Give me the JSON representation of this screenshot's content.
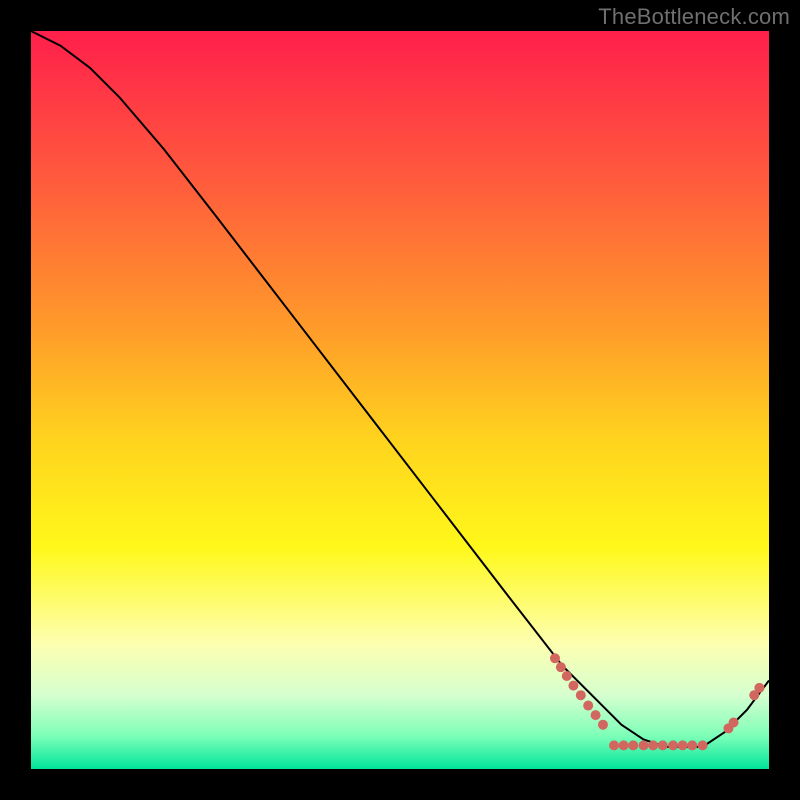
{
  "watermark": "TheBottleneck.com",
  "chart_data": {
    "type": "line",
    "title": "",
    "xlabel": "",
    "ylabel": "",
    "xlim": [
      0,
      100
    ],
    "ylim": [
      0,
      100
    ],
    "background": {
      "type": "vertical-gradient",
      "stops": [
        {
          "pos": 0.0,
          "color": "#ff1f4b"
        },
        {
          "pos": 0.2,
          "color": "#ff5a3d"
        },
        {
          "pos": 0.4,
          "color": "#ff9a2a"
        },
        {
          "pos": 0.55,
          "color": "#ffd21e"
        },
        {
          "pos": 0.7,
          "color": "#fff81a"
        },
        {
          "pos": 0.83,
          "color": "#fdffb0"
        },
        {
          "pos": 0.9,
          "color": "#d6ffcf"
        },
        {
          "pos": 0.955,
          "color": "#7dffb8"
        },
        {
          "pos": 1.0,
          "color": "#00e59a"
        }
      ]
    },
    "series": [
      {
        "name": "curve",
        "color": "#000000",
        "stroke_width": 2,
        "x": [
          0,
          4,
          8,
          12,
          18,
          25,
          35,
          45,
          55,
          65,
          72,
          75,
          78,
          80,
          83,
          86,
          89,
          91,
          94,
          97,
          100
        ],
        "y": [
          100,
          98,
          95,
          91,
          84,
          75,
          62,
          49,
          36,
          23,
          14,
          11,
          8,
          6,
          4,
          3,
          3,
          3,
          5,
          8,
          12
        ]
      }
    ],
    "markers": {
      "color": "#d1675e",
      "radius": 5,
      "points": [
        {
          "x": 71.0,
          "y": 15.0
        },
        {
          "x": 71.8,
          "y": 13.8
        },
        {
          "x": 72.6,
          "y": 12.6
        },
        {
          "x": 73.5,
          "y": 11.3
        },
        {
          "x": 74.5,
          "y": 10.0
        },
        {
          "x": 75.5,
          "y": 8.6
        },
        {
          "x": 76.5,
          "y": 7.3
        },
        {
          "x": 77.5,
          "y": 6.0
        },
        {
          "x": 79.0,
          "y": 3.2
        },
        {
          "x": 80.3,
          "y": 3.2
        },
        {
          "x": 81.6,
          "y": 3.2
        },
        {
          "x": 83.0,
          "y": 3.2
        },
        {
          "x": 84.3,
          "y": 3.2
        },
        {
          "x": 85.6,
          "y": 3.2
        },
        {
          "x": 87.0,
          "y": 3.2
        },
        {
          "x": 88.3,
          "y": 3.2
        },
        {
          "x": 89.6,
          "y": 3.2
        },
        {
          "x": 91.0,
          "y": 3.2
        },
        {
          "x": 94.5,
          "y": 5.5
        },
        {
          "x": 95.2,
          "y": 6.3
        },
        {
          "x": 98.0,
          "y": 10.0
        },
        {
          "x": 98.7,
          "y": 11.0
        }
      ]
    }
  }
}
